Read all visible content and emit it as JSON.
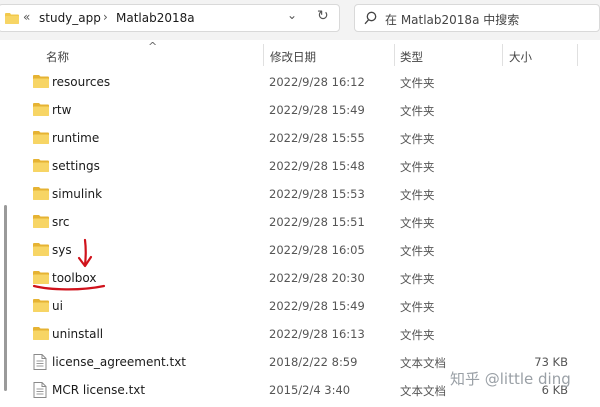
{
  "address_bar": {
    "overflow": "«",
    "crumbs": [
      "study_app",
      "Matlab2018a"
    ],
    "separator": "›",
    "dropdown": "⌄",
    "refresh": "↻"
  },
  "search": {
    "placeholder": "在 Matlab2018a 中搜索"
  },
  "columns": {
    "name": "名称",
    "date": "修改日期",
    "type": "类型",
    "size": "大小",
    "sort_indicator": "^"
  },
  "files": [
    {
      "name": "resources",
      "date": "2022/9/28 16:12",
      "type": "文件夹",
      "size": "",
      "icon": "folder-icon"
    },
    {
      "name": "rtw",
      "date": "2022/9/28 15:49",
      "type": "文件夹",
      "size": "",
      "icon": "folder-icon"
    },
    {
      "name": "runtime",
      "date": "2022/9/28 15:55",
      "type": "文件夹",
      "size": "",
      "icon": "folder-icon"
    },
    {
      "name": "settings",
      "date": "2022/9/28 15:48",
      "type": "文件夹",
      "size": "",
      "icon": "folder-icon"
    },
    {
      "name": "simulink",
      "date": "2022/9/28 15:53",
      "type": "文件夹",
      "size": "",
      "icon": "folder-icon"
    },
    {
      "name": "src",
      "date": "2022/9/28 15:51",
      "type": "文件夹",
      "size": "",
      "icon": "folder-icon"
    },
    {
      "name": "sys",
      "date": "2022/9/28 16:05",
      "type": "文件夹",
      "size": "",
      "icon": "folder-icon"
    },
    {
      "name": "toolbox",
      "date": "2022/9/28 20:30",
      "type": "文件夹",
      "size": "",
      "icon": "folder-icon"
    },
    {
      "name": "ui",
      "date": "2022/9/28 15:49",
      "type": "文件夹",
      "size": "",
      "icon": "folder-icon"
    },
    {
      "name": "uninstall",
      "date": "2022/9/28 16:13",
      "type": "文件夹",
      "size": "",
      "icon": "folder-icon"
    },
    {
      "name": "license_agreement.txt",
      "date": "2018/2/22 8:59",
      "type": "文本文档",
      "size": "73 KB",
      "icon": "text-file-icon"
    },
    {
      "name": "MCR license.txt",
      "date": "2015/2/4 3:40",
      "type": "文本文档",
      "size": "6 KB",
      "icon": "text-file-icon"
    }
  ],
  "watermark": "知乎 @little ding",
  "colors": {
    "folder": "#f2c94c",
    "folder_dark": "#e6b333",
    "annotation": "#d0121b"
  }
}
